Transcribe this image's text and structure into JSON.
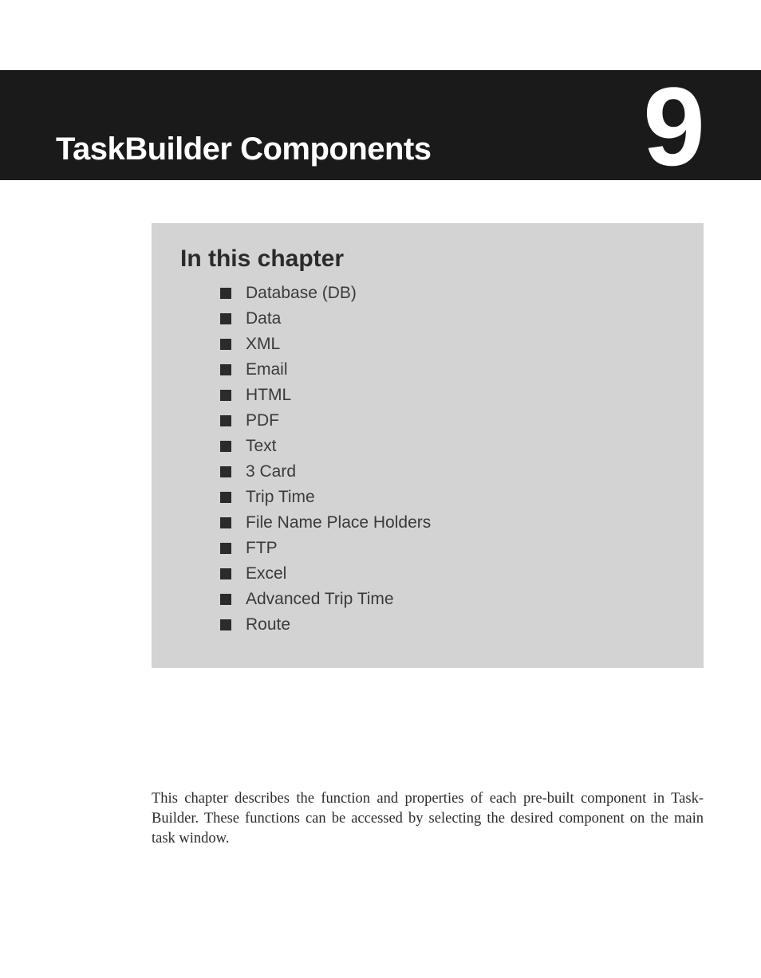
{
  "header": {
    "title": "TaskBuilder Components",
    "chapter_number": "9"
  },
  "box": {
    "heading": "In this chapter",
    "items": [
      "Database (DB)",
      "Data",
      "XML",
      "Email",
      "HTML",
      "PDF",
      "Text",
      "3 Card",
      "Trip Time",
      "File Name Place Holders",
      "FTP",
      "Excel",
      "Advanced Trip Time",
      "Route"
    ]
  },
  "body": {
    "paragraph": "This chapter describes the function and properties of each pre-built component in Task­Builder. These functions can be accessed by selecting the desired component on the main task window."
  }
}
